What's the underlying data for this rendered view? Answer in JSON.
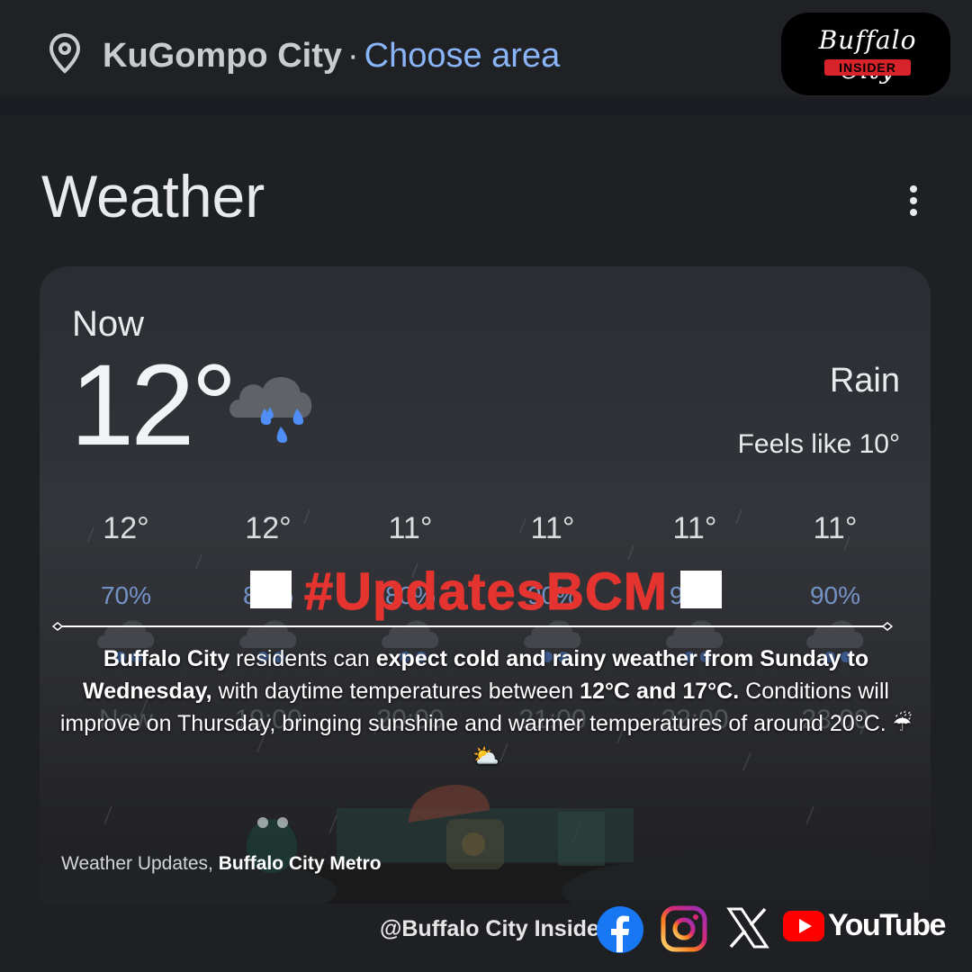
{
  "location": {
    "city": "KuGompo City",
    "separator": "·",
    "choose_area": "Choose area"
  },
  "brand": {
    "script": "Buffalo City",
    "badge": "INSIDER"
  },
  "weather": {
    "title": "Weather",
    "now_label": "Now",
    "temperature": "12°",
    "condition": "Rain",
    "feels_like": "Feels like 10°",
    "icon": "rain-cloud-icon"
  },
  "hourly": [
    {
      "temp": "12°",
      "precip": "70%",
      "time": "Now"
    },
    {
      "temp": "12°",
      "precip": "80%",
      "time": "19:00"
    },
    {
      "temp": "11°",
      "precip": "80%",
      "time": "20:00"
    },
    {
      "temp": "11°",
      "precip": "90%",
      "time": "21:00"
    },
    {
      "temp": "11°",
      "precip": "90%",
      "time": "22:00"
    },
    {
      "temp": "11°",
      "precip": "90%",
      "time": "23:00"
    }
  ],
  "overlay": {
    "hashtag": "#UpdatesBCM",
    "announcement": {
      "p1_bold": "Buffalo City",
      "p2": " residents can ",
      "p3_bold": "expect cold and rainy weather from Sunday to Wednesday,",
      "p4": " with daytime temperatures between ",
      "p5_bold": "12°C and 17°C.",
      "p6": " Conditions will improve on Thursday, bringing sunshine and warmer temperatures of around 20°C. ",
      "emoji": "☔⛅"
    },
    "source_prefix": "Weather Updates, ",
    "source_bold": "Buffalo City Metro"
  },
  "social": {
    "handle": "@Buffalo City Insider",
    "youtube": "YouTube",
    "colors": {
      "facebook": "#1877f2",
      "youtube": "#ff0000",
      "hashtag": "#e5342f",
      "link": "#8ab4f8"
    }
  }
}
